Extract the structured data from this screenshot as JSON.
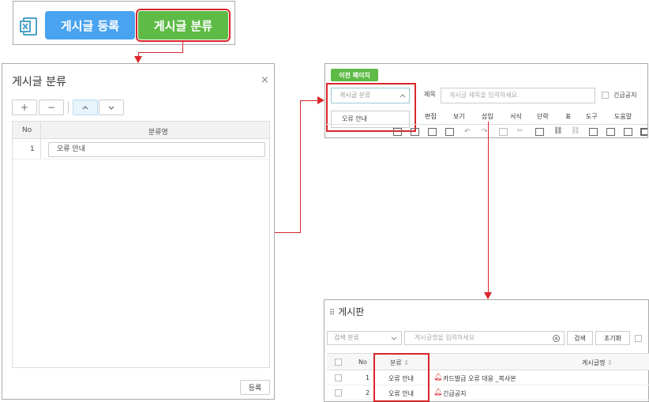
{
  "toolbar": {
    "register_post_label": "게시글 등록",
    "post_category_label": "게시글 분류",
    "excel_icon": "excel-icon"
  },
  "category_modal": {
    "title": "게시글 분류",
    "close_symbol": "×",
    "buttons": {
      "add": "+",
      "remove": "−",
      "move_up": "⌃",
      "move_down": "⌄"
    },
    "columns": [
      "No",
      "분류명"
    ],
    "rows": [
      {
        "no": "1",
        "name": "오류 안내"
      }
    ],
    "submit_label": "등록"
  },
  "editor": {
    "prev_page_label": "이전 페이지",
    "category_select_placeholder": "게시글 분류",
    "dropdown_options": [
      "오류 안내"
    ],
    "title_label": "제목",
    "title_placeholder": "게시글 제목을 입력하세요.",
    "urgent_label": "긴급공지",
    "menu": [
      "편집",
      "보기",
      "삽입",
      "서식",
      "단락",
      "표",
      "도구",
      "도움말"
    ]
  },
  "board": {
    "title": "게시판",
    "category_select_placeholder": "검색 분류",
    "search_placeholder": "게시글명을 입력하세요",
    "search_button": "검색",
    "reset_button": "초기화",
    "columns": {
      "no": "No",
      "category": "분류",
      "post_name": "게시글명"
    },
    "rows": [
      {
        "no": "1",
        "category": "오류 안내",
        "post_name": "카드발급 오류 대응 _복사본"
      },
      {
        "no": "2",
        "category": "오류 안내",
        "post_name": "긴급공지"
      }
    ]
  },
  "colors": {
    "accent_red": "#d9262b",
    "green": "#5dbb46",
    "blue": "#4aa3f0"
  }
}
